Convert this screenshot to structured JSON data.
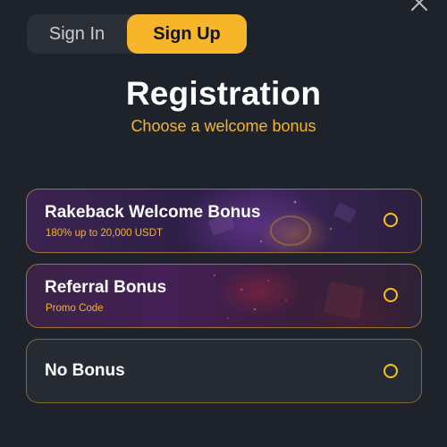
{
  "header": {
    "close_icon": "close-icon"
  },
  "tabs": {
    "sign_in": "Sign In",
    "sign_up": "Sign Up",
    "active": "Sign Up"
  },
  "registration": {
    "title": "Registration",
    "subtitle": "Choose a welcome bonus"
  },
  "bonuses": [
    {
      "title": "Rakeback Welcome Bonus",
      "subtitle": "180% up to 20,000 USDT",
      "selected": false
    },
    {
      "title": "Referral Bonus",
      "subtitle": "Promo Code",
      "selected": false
    },
    {
      "title": "No Bonus",
      "subtitle": "",
      "selected": false
    }
  ],
  "colors": {
    "accent": "#f7b52a",
    "background": "#1d222b",
    "tab_bg": "#2b3038"
  }
}
